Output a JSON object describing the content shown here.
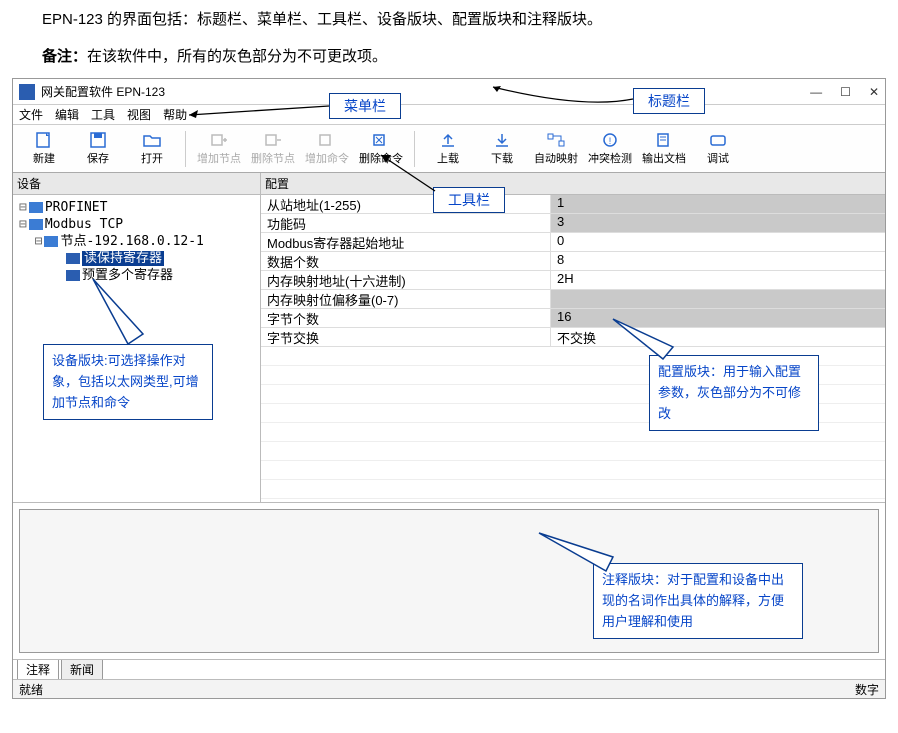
{
  "intro_line": "EPN-123 的界面包括：标题栏、菜单栏、工具栏、设备版块、配置版块和注释版块。",
  "note_label": "备注：",
  "note_text": "在该软件中，所有的灰色部分为不可更改项。",
  "window_title": "网关配置软件 EPN-123",
  "menu": {
    "file": "文件",
    "edit": "编辑",
    "tool": "工具",
    "view": "视图",
    "help": "帮助"
  },
  "toolbar": {
    "new": "新建",
    "save": "保存",
    "open": "打开",
    "add_node": "增加节点",
    "del_node": "删除节点",
    "add_cmd": "增加命令",
    "del_cmd": "删除命令",
    "upload": "上载",
    "download": "下载",
    "auto_map": "自动映射",
    "conflict": "冲突检测",
    "export": "输出文档",
    "debug": "调试"
  },
  "device_panel_title": "设备",
  "tree": {
    "n0": "PROFINET",
    "n1": "Modbus TCP",
    "n2": "节点-192.168.0.12-1",
    "n3": "读保持寄存器",
    "n4": "预置多个寄存器"
  },
  "config_panel_title": "配置",
  "params": [
    {
      "label": "从站地址(1-255)",
      "value": "1",
      "readonly": true
    },
    {
      "label": "功能码",
      "value": "3",
      "readonly": true
    },
    {
      "label": "Modbus寄存器起始地址",
      "value": "0",
      "readonly": false
    },
    {
      "label": "数据个数",
      "value": "8",
      "readonly": false
    },
    {
      "label": "内存映射地址(十六进制)",
      "value": "2H",
      "readonly": false
    },
    {
      "label": "内存映射位偏移量(0-7)",
      "value": "",
      "readonly": true
    },
    {
      "label": "字节个数",
      "value": "16",
      "readonly": true
    },
    {
      "label": "字节交换",
      "value": "不交换",
      "readonly": false
    }
  ],
  "tabs": {
    "comment": "注释",
    "news": "新闻"
  },
  "status": {
    "ready": "就绪",
    "num": "数字"
  },
  "callouts": {
    "title": "标题栏",
    "menu": "菜单栏",
    "tool": "工具栏",
    "device": "设备版块:可选择操作对象，包括以太网类型,可增加节点和命令",
    "config": "配置版块：用于输入配置参数，灰色部分为不可修改",
    "anno": "注释版块：对于配置和设备中出现的名词作出具体的解释，方便用户理解和使用"
  }
}
